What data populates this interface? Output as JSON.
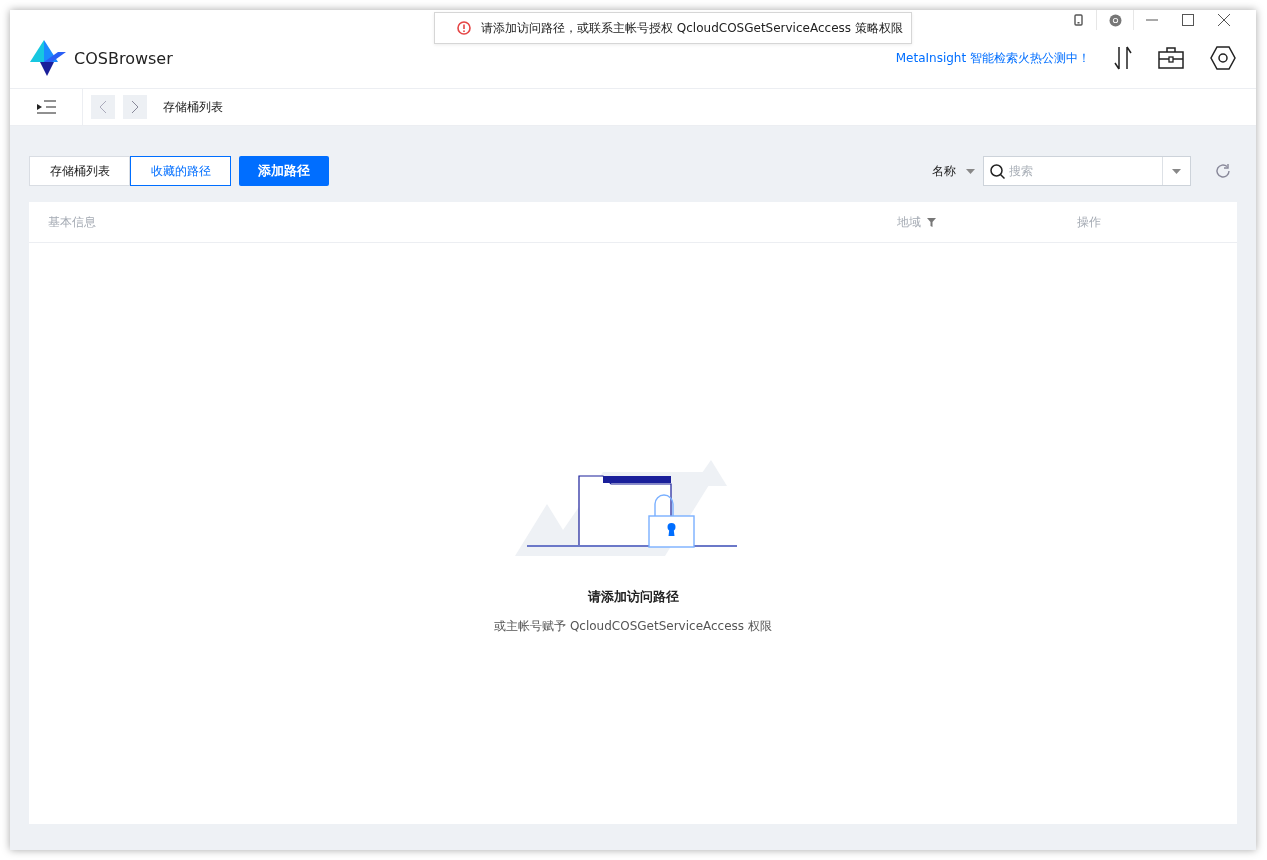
{
  "toast": {
    "message": "请添加访问路径，或联系主帐号授权 QcloudCOSGetServiceAccess 策略权限"
  },
  "app": {
    "name": "COSBrowser"
  },
  "promo": {
    "text": "MetaInsight 智能检索火热公测中！"
  },
  "breadcrumb": {
    "text": "存储桶列表"
  },
  "tabs": [
    {
      "label": "存储桶列表",
      "selected": false
    },
    {
      "label": "收藏的路径",
      "selected": true
    }
  ],
  "add_button": {
    "label": "添加路径"
  },
  "search": {
    "filter_label": "名称",
    "placeholder": "搜索"
  },
  "table": {
    "columns": [
      {
        "label": "基本信息",
        "filter": false
      },
      {
        "label": "地域",
        "filter": true
      },
      {
        "label": "操作",
        "filter": false
      }
    ]
  },
  "empty_state": {
    "title": "请添加访问路径",
    "subtitle": "或主帐号赋予 QcloudCOSGetServiceAccess 权限"
  }
}
